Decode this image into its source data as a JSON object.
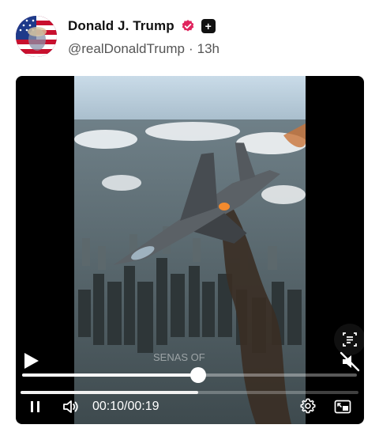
{
  "post": {
    "author_name": "Donald J. Trump",
    "handle": "@realDonaldTrump",
    "separator": "·",
    "timestamp": "13h",
    "verified_icon": "verified-check-icon",
    "badge_icon": "plus-badge-icon",
    "badge_symbol": "+"
  },
  "video": {
    "watermark": "SENAS OF",
    "current_time": "00:10",
    "time_separator": "/",
    "duration": "00:19",
    "scrub_progress": 0.526,
    "buffer_progress": 0.526,
    "controls": {
      "play_icon": "play-icon",
      "pause_icon": "pause-icon",
      "volume_icon": "volume-icon",
      "mute_icon": "muted-speaker-icon",
      "captions_icon": "captions-icon",
      "settings_icon": "gear-icon",
      "pip_icon": "picture-in-picture-icon"
    }
  },
  "colors": {
    "accent_verified": "#e0245e",
    "text_primary": "#111111",
    "text_secondary": "#555555",
    "video_bg": "#000000"
  }
}
